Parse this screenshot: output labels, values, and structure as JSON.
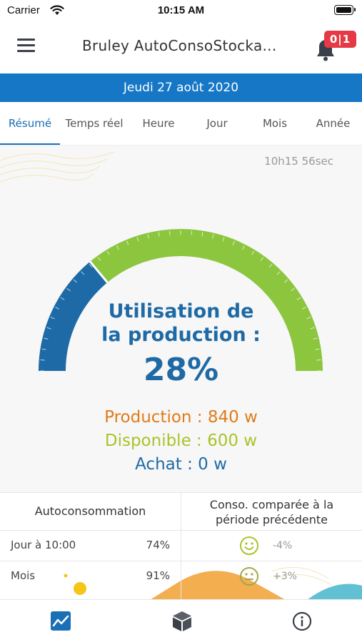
{
  "status_bar": {
    "carrier": "Carrier",
    "time": "10:15 AM"
  },
  "header": {
    "title": "Bruley AutoConsoStocka...",
    "notification_badge": "0|1"
  },
  "date_bar": {
    "date": "Jeudi 27 août 2020"
  },
  "tabs": [
    {
      "label": "Résumé",
      "active": true
    },
    {
      "label": "Temps réel",
      "active": false
    },
    {
      "label": "Heure",
      "active": false
    },
    {
      "label": "Jour",
      "active": false
    },
    {
      "label": "Mois",
      "active": false
    },
    {
      "label": "Année",
      "active": false
    }
  ],
  "summary": {
    "timestamp": "10h15 56sec",
    "gauge": {
      "title_line1": "Utilisation de",
      "title_line2": "la production :",
      "value": "28%",
      "fraction": 0.28,
      "used_color": "#1e6aa6",
      "available_color": "#8cc63f"
    },
    "production": "Production : 840 w",
    "disponible": "Disponible : 600 w",
    "achat": "Achat : 0 w"
  },
  "table": {
    "header_left": "Autoconsommation",
    "header_right_line1": "Conso. comparée à la",
    "header_right_line2": "période précédente",
    "rows": [
      {
        "label": "Jour à 10:00",
        "percent": "74%",
        "comparison": "-4%",
        "smiley_color": "#a8c42a",
        "smiley": "happy"
      },
      {
        "label": "Mois",
        "percent": "91%",
        "comparison": "+3%",
        "smiley_color": "#a3a84a",
        "smiley": "neutral"
      }
    ]
  },
  "bottom_nav": [
    {
      "name": "chart-icon",
      "active": true
    },
    {
      "name": "cube-icon",
      "active": false
    },
    {
      "name": "info-icon",
      "active": false
    }
  ]
}
